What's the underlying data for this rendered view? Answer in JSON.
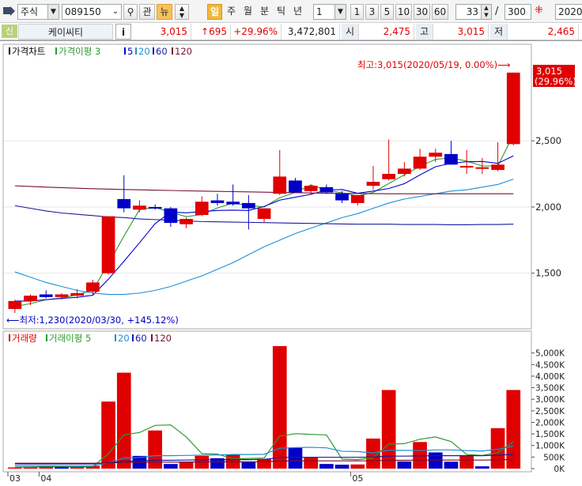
{
  "toolbar": {
    "market": "주식",
    "code": "089150",
    "btn_watch": "관",
    "btn_news": "뉴",
    "periods": [
      "일",
      "주",
      "월",
      "분",
      "틱",
      "년"
    ],
    "interval_value": "1",
    "quick_intervals": [
      "1",
      "3",
      "5",
      "10",
      "30",
      "60"
    ],
    "count_value": "33",
    "total_value": "300",
    "date_value": "2020/"
  },
  "infobar": {
    "badge": "신",
    "name": "케이씨티",
    "info_btn": "i",
    "price": "3,015",
    "change": "↑695",
    "change_rate": "+29.96%",
    "volume": "3,472,801",
    "open_label": "시",
    "open": "2,475",
    "high_label": "고",
    "high": "3,015",
    "low_label": "저",
    "low": "2,465"
  },
  "colors": {
    "up": "#e00000",
    "down": "#0000c8",
    "ma3": "#2e9a2e",
    "ma5": "#0000d0",
    "ma20": "#1e8fd6",
    "ma60": "#1a1aa0",
    "ma120": "#7a1030"
  },
  "chart_data": [
    {
      "type": "candlestick",
      "title": "가격차트",
      "legend": [
        "가격이평 3",
        "5",
        "20",
        "60",
        "120"
      ],
      "ylim": [
        1200,
        3050
      ],
      "yticks": [
        "1,500",
        "2,000",
        "2,500"
      ],
      "yticks_values": [
        1500,
        2000,
        2500
      ],
      "x_labels": [
        "03",
        "04",
        "05"
      ],
      "candles": [
        {
          "o": 1230,
          "h": 1300,
          "l": 1200,
          "c": 1290
        },
        {
          "o": 1290,
          "h": 1340,
          "l": 1260,
          "c": 1330
        },
        {
          "o": 1340,
          "h": 1370,
          "l": 1310,
          "c": 1320
        },
        {
          "o": 1320,
          "h": 1350,
          "l": 1300,
          "c": 1340
        },
        {
          "o": 1330,
          "h": 1380,
          "l": 1310,
          "c": 1350
        },
        {
          "o": 1360,
          "h": 1450,
          "l": 1340,
          "c": 1430
        },
        {
          "o": 1500,
          "h": 1930,
          "l": 1490,
          "c": 1930
        },
        {
          "o": 2060,
          "h": 2240,
          "l": 1960,
          "c": 1990
        },
        {
          "o": 1980,
          "h": 2050,
          "l": 1960,
          "c": 2010
        },
        {
          "o": 2000,
          "h": 2020,
          "l": 1980,
          "c": 1990
        },
        {
          "o": 1990,
          "h": 2000,
          "l": 1850,
          "c": 1880
        },
        {
          "o": 1870,
          "h": 1920,
          "l": 1840,
          "c": 1910
        },
        {
          "o": 1940,
          "h": 2080,
          "l": 1930,
          "c": 2040
        },
        {
          "o": 2050,
          "h": 2100,
          "l": 2010,
          "c": 2030
        },
        {
          "o": 2040,
          "h": 2170,
          "l": 2010,
          "c": 2020
        },
        {
          "o": 2030,
          "h": 2090,
          "l": 1830,
          "c": 1990
        },
        {
          "o": 1910,
          "h": 1990,
          "l": 1880,
          "c": 1990
        },
        {
          "o": 2100,
          "h": 2430,
          "l": 2090,
          "c": 2230
        },
        {
          "o": 2200,
          "h": 2220,
          "l": 2120,
          "c": 2110
        },
        {
          "o": 2120,
          "h": 2170,
          "l": 2090,
          "c": 2160
        },
        {
          "o": 2150,
          "h": 2170,
          "l": 2100,
          "c": 2110
        },
        {
          "o": 2100,
          "h": 2120,
          "l": 2030,
          "c": 2050
        },
        {
          "o": 2030,
          "h": 2090,
          "l": 2010,
          "c": 2090
        },
        {
          "o": 2160,
          "h": 2310,
          "l": 2130,
          "c": 2190
        },
        {
          "o": 2210,
          "h": 2510,
          "l": 2200,
          "c": 2250
        },
        {
          "o": 2250,
          "h": 2340,
          "l": 2230,
          "c": 2290
        },
        {
          "o": 2290,
          "h": 2440,
          "l": 2280,
          "c": 2380
        },
        {
          "o": 2380,
          "h": 2440,
          "l": 2340,
          "c": 2410
        },
        {
          "o": 2400,
          "h": 2500,
          "l": 2320,
          "c": 2320
        },
        {
          "o": 2310,
          "h": 2430,
          "l": 2250,
          "c": 2310
        },
        {
          "o": 2300,
          "h": 2370,
          "l": 2250,
          "c": 2300
        },
        {
          "o": 2280,
          "h": 2490,
          "l": 2270,
          "c": 2320
        },
        {
          "o": 2475,
          "h": 3015,
          "l": 2465,
          "c": 3015
        }
      ],
      "ma_series": [
        {
          "name": "3",
          "values": [
            1250,
            1270,
            1300,
            1313,
            1337,
            1373,
            1570,
            1780,
            1980,
            1997,
            1960,
            1927,
            1943,
            1993,
            2030,
            2013,
            2000,
            2070,
            2110,
            2167,
            2127,
            2107,
            2083,
            2110,
            2177,
            2243,
            2307,
            2360,
            2370,
            2347,
            2310,
            2310,
            2545
          ]
        },
        {
          "name": "5",
          "values": [
            1290,
            1290,
            1300,
            1310,
            1318,
            1334,
            1454,
            1590,
            1730,
            1874,
            1962,
            1956,
            1966,
            1974,
            1976,
            1974,
            2004,
            2052,
            2074,
            2096,
            2128,
            2132,
            2104,
            2120,
            2140,
            2176,
            2242,
            2304,
            2330,
            2342,
            2344,
            2330,
            2386
          ]
        },
        {
          "name": "20",
          "values": [
            1510,
            1470,
            1430,
            1400,
            1370,
            1350,
            1340,
            1340,
            1350,
            1370,
            1400,
            1440,
            1480,
            1530,
            1580,
            1640,
            1700,
            1750,
            1800,
            1840,
            1880,
            1920,
            1950,
            1990,
            2030,
            2060,
            2080,
            2100,
            2120,
            2130,
            2150,
            2170,
            2210
          ]
        },
        {
          "name": "60",
          "values": [
            2010,
            1990,
            1970,
            1955,
            1945,
            1935,
            1925,
            1920,
            1910,
            1905,
            1900,
            1895,
            1890,
            1888,
            1886,
            1884,
            1882,
            1880,
            1878,
            1876,
            1874,
            1872,
            1870,
            1870,
            1870,
            1868,
            1868,
            1868,
            1866,
            1866,
            1868,
            1868,
            1870
          ]
        },
        {
          "name": "120",
          "values": [
            2160,
            2155,
            2150,
            2146,
            2142,
            2138,
            2135,
            2132,
            2130,
            2127,
            2125,
            2122,
            2120,
            2118,
            2116,
            2114,
            2112,
            2110,
            2108,
            2106,
            2104,
            2103,
            2102,
            2101,
            2100,
            2100,
            2100,
            2100,
            2100,
            2100,
            2100,
            2100,
            2100
          ]
        }
      ],
      "annotations": {
        "high": "최고:3,015(2020/05/19, 0.00%)⟶",
        "low": "⟵최저:1,230(2020/03/30, +145.12%)",
        "last_price": "3,015",
        "last_rate": "(29.96%)"
      }
    },
    {
      "type": "bar",
      "title": "거래량",
      "legend": [
        "거래이평 5",
        "20",
        "60",
        "120"
      ],
      "ylim": [
        0,
        5400000
      ],
      "yticks": [
        "0K",
        "500K",
        "1,000K",
        "1,500K",
        "2,000K",
        "2,500K",
        "3,000K",
        "3,500K",
        "4,000K",
        "4,500K",
        "5,000K"
      ],
      "yticks_values": [
        0,
        500000,
        1000000,
        1500000,
        2000000,
        2500000,
        3000000,
        3500000,
        4000000,
        4500000,
        5000000
      ],
      "volumes": [
        50000,
        70000,
        120000,
        80000,
        70000,
        120000,
        2900000,
        4150000,
        550000,
        1650000,
        200000,
        300000,
        550000,
        450000,
        600000,
        300000,
        420000,
        5300000,
        900000,
        480000,
        200000,
        170000,
        180000,
        1300000,
        3400000,
        310000,
        1150000,
        700000,
        300000,
        580000,
        100000,
        1750000,
        3400000
      ],
      "up": [
        true,
        true,
        true,
        false,
        true,
        true,
        true,
        true,
        false,
        true,
        false,
        true,
        true,
        false,
        true,
        false,
        true,
        true,
        false,
        true,
        false,
        false,
        true,
        true,
        true,
        false,
        true,
        false,
        false,
        true,
        false,
        true,
        true
      ],
      "ma_series": [
        {
          "name": "5",
          "values": [
            60000,
            65000,
            80000,
            80000,
            78000,
            92000,
            640000,
            1460000,
            1560000,
            1870000,
            1890000,
            1370000,
            650000,
            630000,
            420000,
            440000,
            460000,
            1410000,
            1510000,
            1480000,
            1460000,
            410000,
            390000,
            470000,
            1060000,
            1080000,
            1270000,
            1370000,
            1170000,
            610000,
            570000,
            690000,
            1170000
          ]
        },
        {
          "name": "20",
          "values": [
            120000,
            120000,
            120000,
            118000,
            116000,
            120000,
            260000,
            460000,
            480000,
            560000,
            560000,
            570000,
            580000,
            590000,
            610000,
            610000,
            620000,
            880000,
            910000,
            920000,
            900000,
            750000,
            740000,
            680000,
            790000,
            790000,
            780000,
            810000,
            810000,
            780000,
            760000,
            840000,
            970000
          ]
        },
        {
          "name": "60",
          "values": [
            200000,
            200000,
            200000,
            200000,
            200000,
            200000,
            260000,
            320000,
            330000,
            360000,
            360000,
            370000,
            380000,
            380000,
            390000,
            390000,
            400000,
            480000,
            490000,
            490000,
            490000,
            490000,
            490000,
            500000,
            540000,
            540000,
            550000,
            560000,
            560000,
            560000,
            560000,
            580000,
            620000
          ]
        },
        {
          "name": "120",
          "values": [
            230000,
            230000,
            230000,
            230000,
            230000,
            230000,
            250000,
            270000,
            270000,
            280000,
            280000,
            285000,
            290000,
            290000,
            295000,
            295000,
            300000,
            330000,
            335000,
            335000,
            335000,
            335000,
            335000,
            340000,
            360000,
            360000,
            365000,
            370000,
            370000,
            370000,
            370000,
            380000,
            400000
          ]
        }
      ]
    }
  ]
}
